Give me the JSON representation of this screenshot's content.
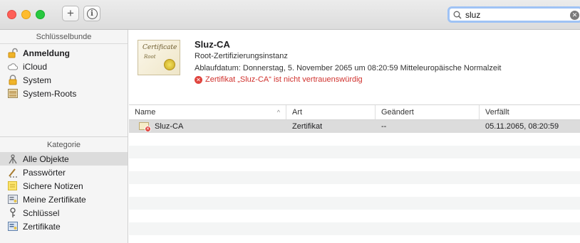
{
  "toolbar": {
    "add_icon": "plus-icon",
    "info_icon": "info-icon",
    "search": {
      "value": "sluz",
      "icon": "magnifier-icon",
      "clear_icon": "clear-icon"
    }
  },
  "sidebar": {
    "keychains_header": "Schlüsselbunde",
    "keychains": [
      {
        "label": "Anmeldung",
        "icon": "unlocked-padlock-icon",
        "bold": true
      },
      {
        "label": "iCloud",
        "icon": "cloud-icon"
      },
      {
        "label": "System",
        "icon": "padlock-icon"
      },
      {
        "label": "System-Roots",
        "icon": "cabinet-icon"
      }
    ],
    "category_header": "Kategorie",
    "categories": [
      {
        "label": "Alle Objekte",
        "icon": "all-items-icon",
        "selected": true
      },
      {
        "label": "Passwörter",
        "icon": "password-icon"
      },
      {
        "label": "Sichere Notizen",
        "icon": "note-icon"
      },
      {
        "label": "Meine Zertifikate",
        "icon": "my-certificate-icon"
      },
      {
        "label": "Schlüssel",
        "icon": "key-icon"
      },
      {
        "label": "Zertifikate",
        "icon": "certificate-icon"
      }
    ]
  },
  "certificate": {
    "image_text_title": "Certificate",
    "image_text_sub": "Root",
    "name": "Sluz-CA",
    "type": "Root-Zertifizierungsinstanz",
    "expiry": "Ablaufdatum: Donnerstag, 5. November 2065 um 08:20:59 Mitteleuropäische Normalzeit",
    "warning": "Zertifikat „Sluz-CA“ ist nicht vertrauenswürdig",
    "warning_color": "#d0312d"
  },
  "table": {
    "columns": {
      "name": "Name",
      "art": "Art",
      "changed": "Geändert",
      "expires": "Verfällt"
    },
    "rows": [
      {
        "name": "Sluz-CA",
        "art": "Zertifikat",
        "changed": "--",
        "expires": "05.11.2065, 08:20:59"
      }
    ]
  },
  "colors": {
    "close": "#fe5f57",
    "minimize": "#febc2e",
    "maximize": "#28c840",
    "search_focus": "#9fc3f5",
    "selection": "#dcdcdc"
  }
}
